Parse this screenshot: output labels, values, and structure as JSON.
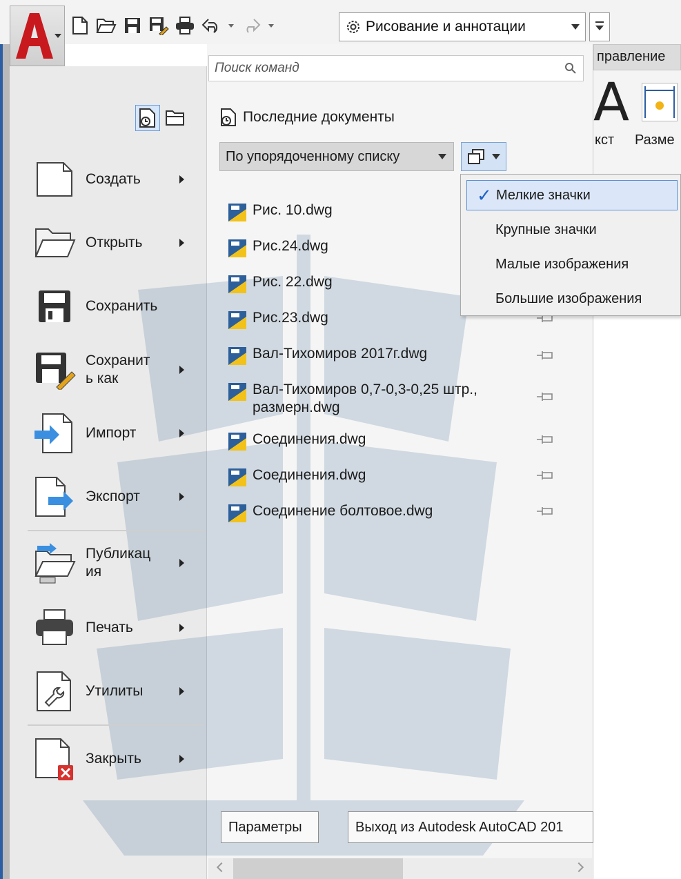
{
  "qat": {
    "workspace": "Рисование и аннотации",
    "icons": [
      "new-icon",
      "open-icon",
      "save-icon",
      "save-as-icon",
      "print-icon",
      "undo-icon",
      "redo-icon"
    ]
  },
  "ribbon": {
    "tab_partial": "правление",
    "label_text": "кст",
    "label_dim": "Разме"
  },
  "menu": {
    "search_placeholder": "Поиск команд",
    "commands": [
      {
        "label": "Создать",
        "has_submenu": true
      },
      {
        "label": "Открыть",
        "has_submenu": true
      },
      {
        "label": "Сохранить",
        "has_submenu": false
      },
      {
        "label": "Сохранит\nь как",
        "has_submenu": true
      },
      {
        "label": "Импорт",
        "has_submenu": true
      },
      {
        "label": "Экспорт",
        "has_submenu": true
      },
      {
        "label": "Публикац\nия",
        "has_submenu": true
      },
      {
        "label": "Печать",
        "has_submenu": true
      },
      {
        "label": "Утилиты",
        "has_submenu": true
      },
      {
        "label": "Закрыть",
        "has_submenu": true
      }
    ],
    "recent_title": "Последние документы",
    "sort_value": "По упорядоченному списку",
    "files": [
      "Рис. 10.dwg",
      "Рис.24.dwg",
      "Рис. 22.dwg",
      "Рис.23.dwg",
      "Вал-Тихомиров 2017г.dwg",
      "Вал-Тихомиров 0,7-0,3-0,25 штр., размерн.dwg",
      "Соединения.dwg",
      "Соединения.dwg",
      "Соединение болтовое.dwg"
    ],
    "view_options": [
      {
        "label": "Мелкие значки",
        "checked": true
      },
      {
        "label": "Крупные значки",
        "checked": false
      },
      {
        "label": "Малые изображения",
        "checked": false
      },
      {
        "label": "Большие изображения",
        "checked": false
      }
    ],
    "options_button": "Параметры",
    "exit_button": "Выход из Autodesk AutoCAD 201"
  },
  "colors": {
    "accent": "#2c5ea3",
    "logo_red": "#c8191f",
    "selection": "#dbe7f8"
  }
}
